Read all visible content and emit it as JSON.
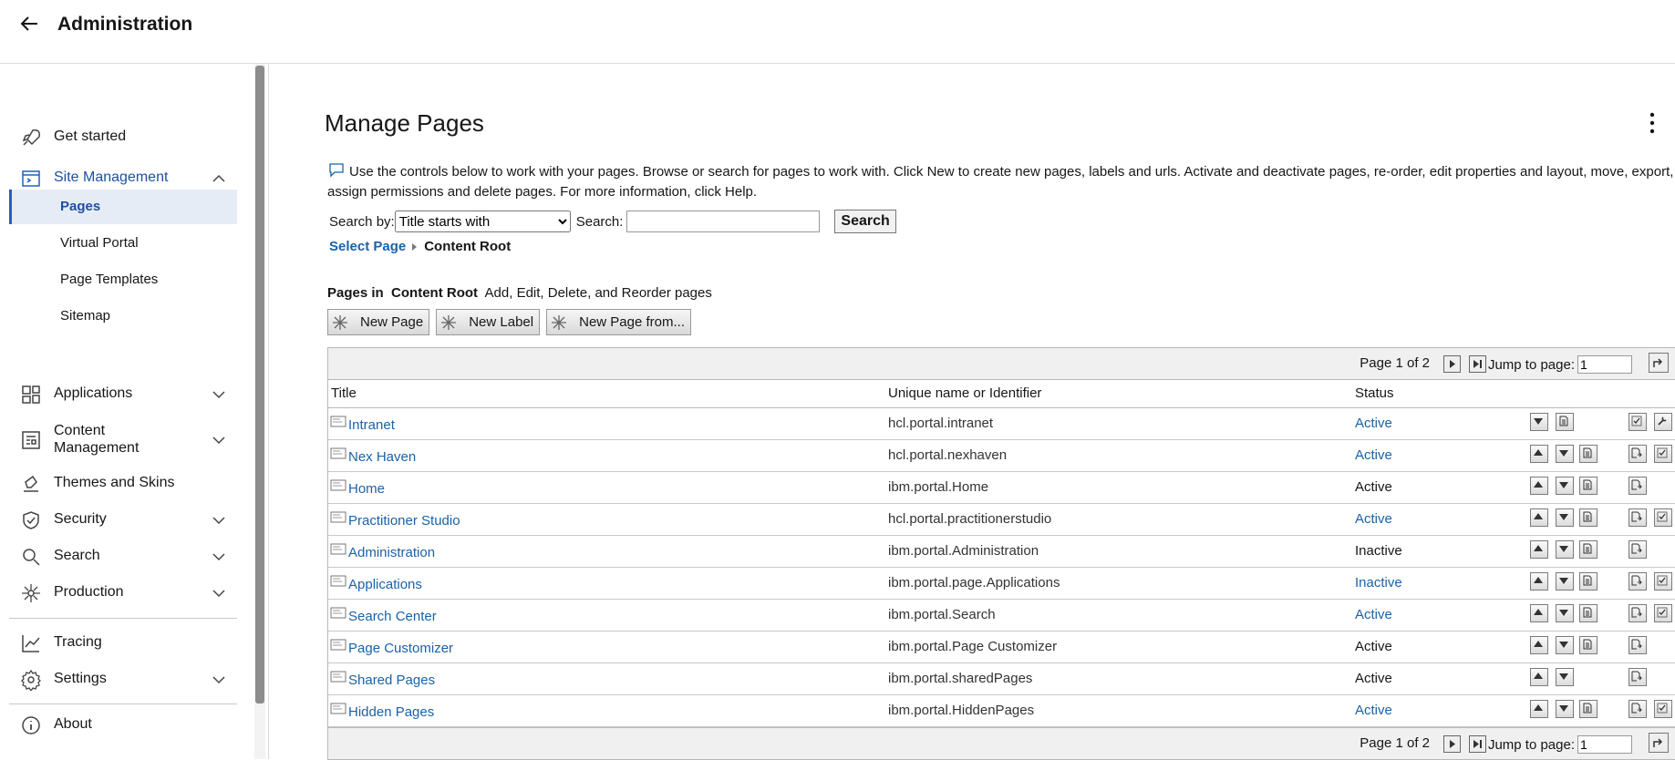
{
  "header": {
    "title": "Administration"
  },
  "sidebar": {
    "items": [
      {
        "label": "Get started"
      },
      {
        "label": "Site Management"
      },
      {
        "label": "Applications"
      },
      {
        "label": "Content Management"
      },
      {
        "label": "Themes and Skins"
      },
      {
        "label": "Security"
      },
      {
        "label": "Search"
      },
      {
        "label": "Production"
      },
      {
        "label": "Tracing"
      },
      {
        "label": "Settings"
      },
      {
        "label": "About"
      }
    ],
    "sub_items": [
      {
        "label": "Pages",
        "active": true
      },
      {
        "label": "Virtual Portal"
      },
      {
        "label": "Page Templates"
      },
      {
        "label": "Sitemap"
      }
    ]
  },
  "main": {
    "title": "Manage Pages",
    "help_text": "Use the controls below to work with your pages. Browse or search for pages to work with. Click New to create new pages, labels and urls. Activate and deactivate pages, re-order, edit properties and layout, move, export, assign permissions and delete pages. For more information, click Help.",
    "search": {
      "by_label": "Search by:",
      "by_value": "Title starts with",
      "search_label": "Search:",
      "search_value": "",
      "button": "Search"
    },
    "breadcrumb": {
      "link": "Select Page",
      "current": "Content Root"
    },
    "pages_in": {
      "prefix": "Pages in",
      "root": "Content Root",
      "desc": "Add, Edit, Delete, and Reorder pages"
    },
    "buttons": {
      "new_page": "New Page",
      "new_label": "New Label",
      "new_page_from": "New Page from..."
    },
    "pager": {
      "text": "Page 1 of 2",
      "jump_label": "Jump to page:",
      "jump_value": "1"
    },
    "columns": {
      "title": "Title",
      "uid": "Unique name or Identifier",
      "status": "Status"
    },
    "rows": [
      {
        "title": "Intranet",
        "uid": "hcl.portal.intranet",
        "status": "Active"
      },
      {
        "title": "Nex Haven",
        "uid": "hcl.portal.nexhaven",
        "status": "Active"
      },
      {
        "title": "Home",
        "uid": "ibm.portal.Home",
        "status": "Active"
      },
      {
        "title": "Practitioner Studio",
        "uid": "hcl.portal.practitionerstudio",
        "status": "Active"
      },
      {
        "title": "Administration",
        "uid": "ibm.portal.Administration",
        "status": "Inactive"
      },
      {
        "title": "Applications",
        "uid": "ibm.portal.page.Applications",
        "status": "Inactive"
      },
      {
        "title": "Search Center",
        "uid": "ibm.portal.Search",
        "status": "Active"
      },
      {
        "title": "Page Customizer",
        "uid": "ibm.portal.Page Customizer",
        "status": "Active"
      },
      {
        "title": "Shared Pages",
        "uid": "ibm.portal.sharedPages",
        "status": "Active"
      },
      {
        "title": "Hidden Pages",
        "uid": "ibm.portal.HiddenPages",
        "status": "Active"
      }
    ]
  },
  "colors": {
    "accent": "#1f62c0",
    "link": "#1a62a8",
    "active_bg": "#e6ecf6"
  }
}
